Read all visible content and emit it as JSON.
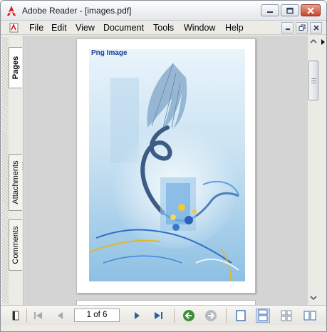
{
  "window": {
    "title": "Adobe Reader - [images.pdf]"
  },
  "menu": {
    "items": [
      "File",
      "Edit",
      "View",
      "Document",
      "Tools",
      "Window",
      "Help"
    ]
  },
  "nav_tabs": {
    "pages": "Pages",
    "attachments": "Attachments",
    "comments": "Comments"
  },
  "document": {
    "image_label": "Png Image"
  },
  "toolbar": {
    "page_indicator": "1 of 6"
  },
  "colors": {
    "accent_blue": "#1b3d96",
    "go_green": "#3f8f3a",
    "close_red": "#c7432c"
  },
  "icons": [
    "adobe-reader-icon",
    "pdf-document-icon",
    "minimize-icon",
    "maximize-icon",
    "close-icon",
    "first-page-icon",
    "previous-page-icon",
    "next-page-icon",
    "last-page-icon",
    "go-back-icon",
    "go-forward-icon",
    "single-page-icon",
    "continuous-icon",
    "continuous-facing-icon",
    "facing-icon"
  ]
}
